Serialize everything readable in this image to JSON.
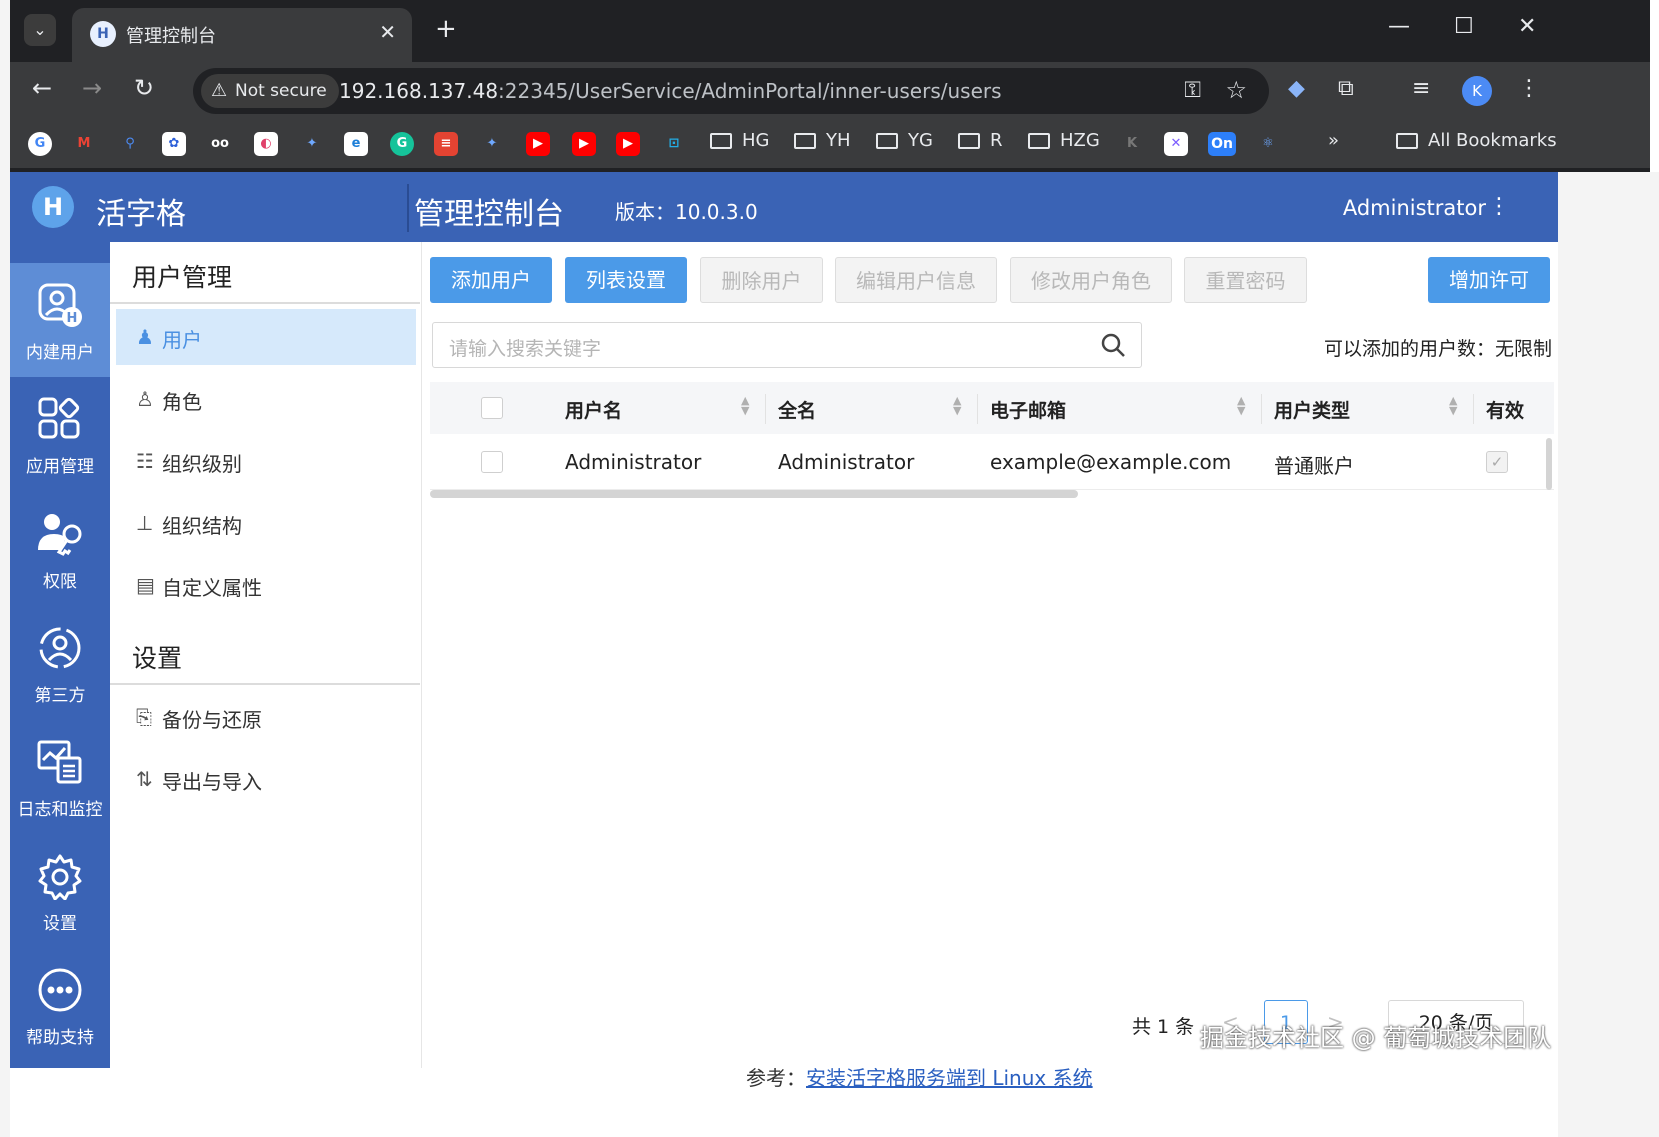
{
  "browser": {
    "tab_title": "管理控制台",
    "security_label": "Not secure",
    "url_host": "192.168.137.48",
    "url_rest": ":22345/UserService/AdminPortal/inner-users/users",
    "profile_initial": "K",
    "bookmark_folders": [
      "HG",
      "YH",
      "YG",
      "R",
      "HZG"
    ],
    "all_bookmarks": "All Bookmarks",
    "bookmark_more": "»"
  },
  "app": {
    "logo_letter": "H",
    "name": "活字格",
    "console": "管理控制台",
    "version": "版本：10.0.3.0",
    "user": "Administrator"
  },
  "leftnav": [
    {
      "label": "内建用户",
      "icon": "user-h-icon"
    },
    {
      "label": "应用管理",
      "icon": "apps-icon"
    },
    {
      "label": "权限",
      "icon": "permission-key-icon"
    },
    {
      "label": "第三方",
      "icon": "third-party-icon"
    },
    {
      "label": "日志和监控",
      "icon": "log-monitor-icon"
    },
    {
      "label": "设置",
      "icon": "settings-gear-icon"
    },
    {
      "label": "帮助支持",
      "icon": "help-dots-icon"
    }
  ],
  "submenu": {
    "section1": "用户管理",
    "items1": [
      "用户",
      "角色",
      "组织级别",
      "组织结构",
      "自定义属性"
    ],
    "section2": "设置",
    "items2": [
      "备份与还原",
      "导出与导入"
    ]
  },
  "toolbar": {
    "add_user": "添加用户",
    "list_settings": "列表设置",
    "delete_user": "删除用户",
    "edit_user": "编辑用户信息",
    "change_role": "修改用户角色",
    "reset_password": "重置密码",
    "add_license": "增加许可"
  },
  "search": {
    "placeholder": "请输入搜索关键字",
    "quota": "可以添加的用户数：无限制"
  },
  "table": {
    "headers": [
      "用户名",
      "全名",
      "电子邮箱",
      "用户类型",
      "有效"
    ],
    "rows": [
      {
        "username": "Administrator",
        "fullname": "Administrator",
        "email": "example@example.com",
        "type": "普通账户",
        "valid": true
      }
    ]
  },
  "pager": {
    "total": "共 1 条",
    "current": "1",
    "page_size": "20 条/页",
    "prev": "<",
    "next": ">"
  },
  "watermark": "掘金技术社区 @ 葡萄城技术团队",
  "footer_ref_prefix": "参考：",
  "footer_ref_link": "安装活字格服务端到 Linux 系统"
}
